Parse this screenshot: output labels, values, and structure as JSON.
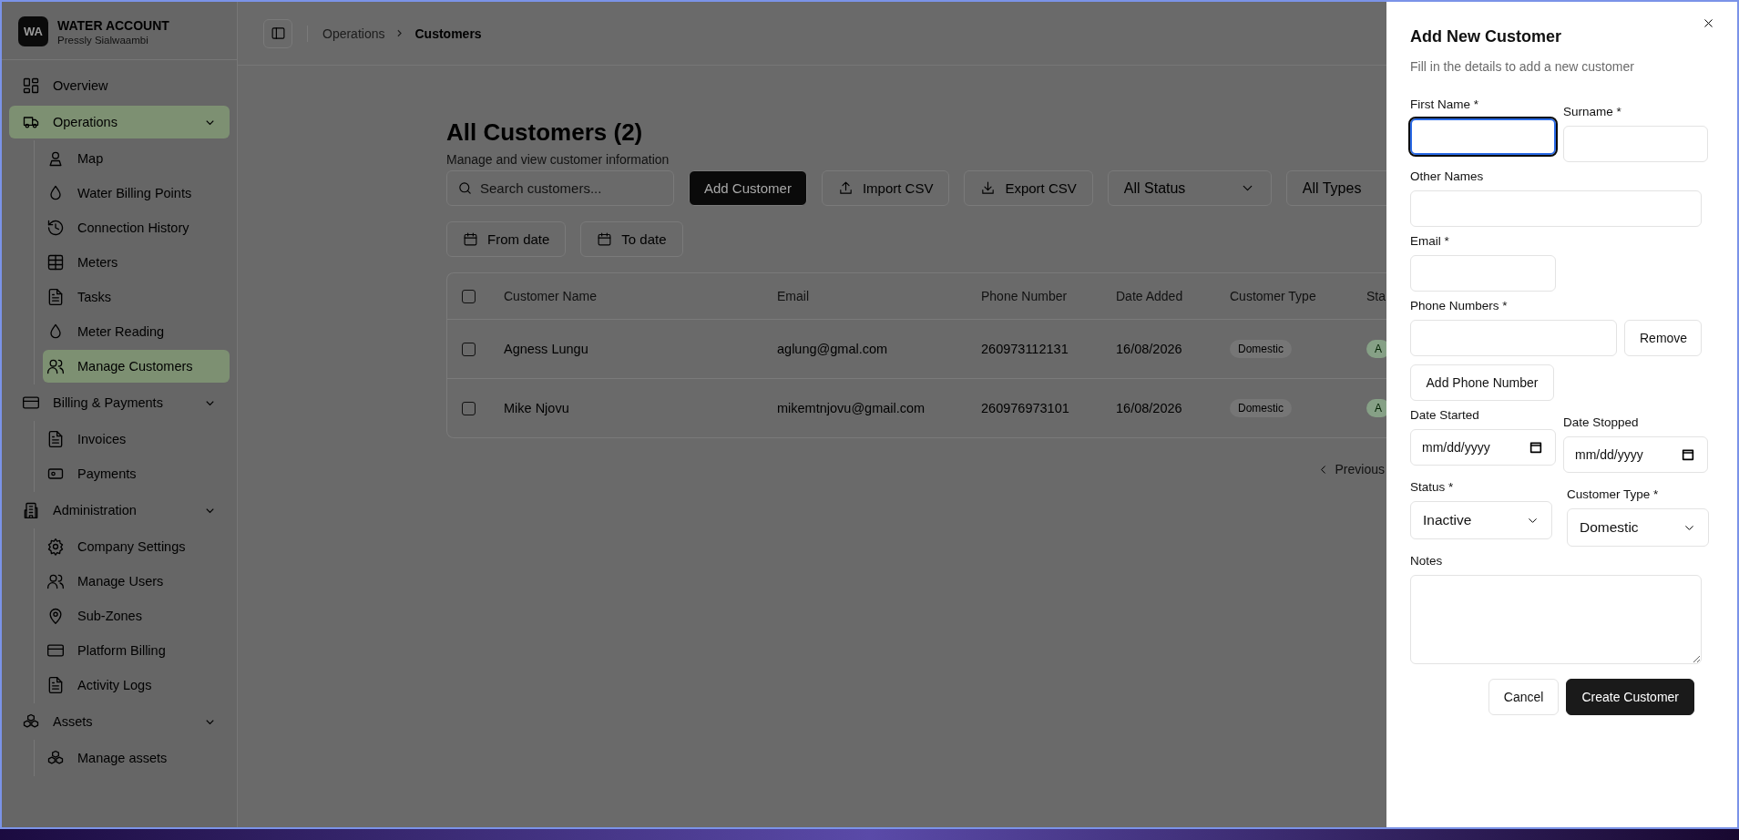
{
  "sidebar": {
    "brand": {
      "initials": "WA",
      "name": "WATER ACCOUNT",
      "user": "Pressly Sialwaambi"
    },
    "nav": [
      {
        "label": "Overview",
        "selected": false
      },
      {
        "label": "Operations",
        "selected": true,
        "expanded": true,
        "children": [
          {
            "label": "Map",
            "selected": false
          },
          {
            "label": "Water Billing Points",
            "selected": false
          },
          {
            "label": "Connection History",
            "selected": false
          },
          {
            "label": "Meters",
            "selected": false
          },
          {
            "label": "Tasks",
            "selected": false
          },
          {
            "label": "Meter Reading",
            "selected": false
          },
          {
            "label": "Manage Customers",
            "selected": true
          }
        ]
      },
      {
        "label": "Billing & Payments",
        "selected": false,
        "expanded": true,
        "children": [
          {
            "label": "Invoices",
            "selected": false
          },
          {
            "label": "Payments",
            "selected": false
          }
        ]
      },
      {
        "label": "Administration",
        "selected": false,
        "expanded": true,
        "children": [
          {
            "label": "Company Settings",
            "selected": false
          },
          {
            "label": "Manage Users",
            "selected": false
          },
          {
            "label": "Sub-Zones",
            "selected": false
          },
          {
            "label": "Platform Billing",
            "selected": false
          },
          {
            "label": "Activity Logs",
            "selected": false
          }
        ]
      },
      {
        "label": "Assets",
        "selected": false,
        "expanded": true,
        "children": [
          {
            "label": "Manage assets",
            "selected": false
          }
        ]
      }
    ]
  },
  "breadcrumb": [
    "Operations",
    "Customers"
  ],
  "page": {
    "title": "All Customers (2)",
    "subtitle": "Manage and view customer information",
    "search": {
      "placeholder": "Search customers..."
    },
    "add_button": "Add Customer",
    "import_button": "Import CSV",
    "export_button": "Export CSV",
    "status_filter": "All Status",
    "type_filter": "All Types",
    "from_date": "From date",
    "to_date": "To date"
  },
  "table": {
    "header_checked": false,
    "columns": [
      "Customer Name",
      "Email",
      "Phone Number",
      "Date Added",
      "Customer Type",
      "Sta"
    ],
    "rows": [
      {
        "checked": false,
        "name": "Agness Lungu",
        "email": "aglung@gmal.com",
        "phone": "260973112131",
        "date_added": "16/08/2026",
        "customer_type": "Domestic",
        "status": "A"
      },
      {
        "checked": false,
        "name": "Mike Njovu",
        "email": "mikemtnjovu@gmail.com",
        "phone": "260976973101",
        "date_added": "16/08/2026",
        "customer_type": "Domestic",
        "status": "A"
      }
    ]
  },
  "pagination": {
    "previous": "Previous"
  },
  "drawer": {
    "title": "Add New Customer",
    "subtitle": "Fill in the details to add a new customer",
    "first_name": {
      "label": "First Name *",
      "focused": true
    },
    "surname": {
      "label": "Surname *",
      "focused": false
    },
    "other_names": {
      "label": "Other Names",
      "focused": false
    },
    "email": {
      "label": "Email *",
      "focused": false
    },
    "phone_numbers": {
      "label": "Phone Numbers *",
      "remove_button": "Remove",
      "add_button": "Add Phone Number"
    },
    "date_started": {
      "label": "Date Started",
      "placeholder": "mm/dd/yyyy"
    },
    "date_stopped": {
      "label": "Date Stopped",
      "placeholder": "mm/dd/yyyy"
    },
    "status": {
      "label": "Status *",
      "value": "Inactive"
    },
    "customer_type": {
      "label": "Customer Type *",
      "value": "Domestic"
    },
    "notes": {
      "label": "Notes"
    },
    "cancel_button": "Cancel",
    "create_button": "Create Customer"
  }
}
